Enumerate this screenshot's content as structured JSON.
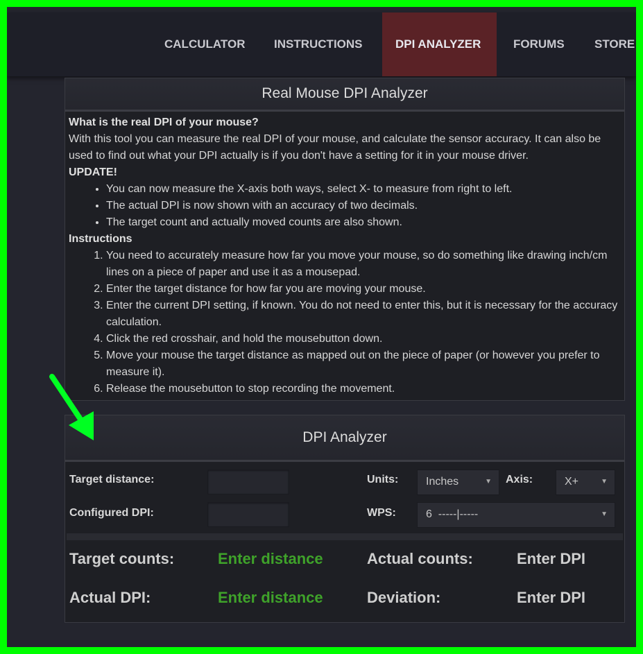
{
  "nav": {
    "items": [
      "CALCULATOR",
      "INSTRUCTIONS",
      "DPI ANALYZER",
      "FORUMS",
      "STORE"
    ],
    "active": "DPI ANALYZER",
    "active_color": "#5a2226"
  },
  "info": {
    "title": "Real Mouse DPI Analyzer",
    "q": "What is the real DPI of your mouse?",
    "intro": "With this tool you can measure the real DPI of your mouse, and calculate the sensor accuracy. It can also be used to find out what your DPI actually is if you don't have a setting for it in your mouse driver.",
    "update_heading": "UPDATE!",
    "updates": [
      "You can now measure the X-axis both ways, select X- to measure from right to left.",
      "The actual DPI is now shown with an accuracy of two decimals.",
      "The target count and actually moved counts are also shown."
    ],
    "instr_heading": "Instructions",
    "steps": [
      "You need to accurately measure how far you move your mouse, so do something like drawing inch/cm lines on a piece of paper and use it as a mousepad.",
      "Enter the target distance for how far you are moving your mouse.",
      "Enter the current DPI setting, if known. You do not need to enter this, but it is necessary for the accuracy calculation.",
      "Click the red crosshair, and hold the mousebutton down.",
      "Move your mouse the target distance as mapped out on the piece of paper (or however you prefer to measure it).",
      "Release the mousebutton to stop recording the movement."
    ]
  },
  "analyzer": {
    "title": "DPI Analyzer",
    "target_label": "Target distance:",
    "target_value": "",
    "dpi_label": "Configured DPI:",
    "dpi_value": "",
    "units_label": "Units:",
    "units_value": "Inches",
    "axis_label": "Axis:",
    "axis_value": "X+",
    "wps_label": "WPS:",
    "wps_value": "6  -----|-----",
    "target_counts_label": "Target counts:",
    "target_counts_value": "Enter distance",
    "actual_counts_label": "Actual counts:",
    "actual_counts_value": "Enter DPI",
    "actual_dpi_label": "Actual DPI:",
    "actual_dpi_value": "Enter distance",
    "deviation_label": "Deviation:",
    "deviation_value": "Enter DPI"
  },
  "annotation": {
    "arrow_color": "#00ff22"
  }
}
